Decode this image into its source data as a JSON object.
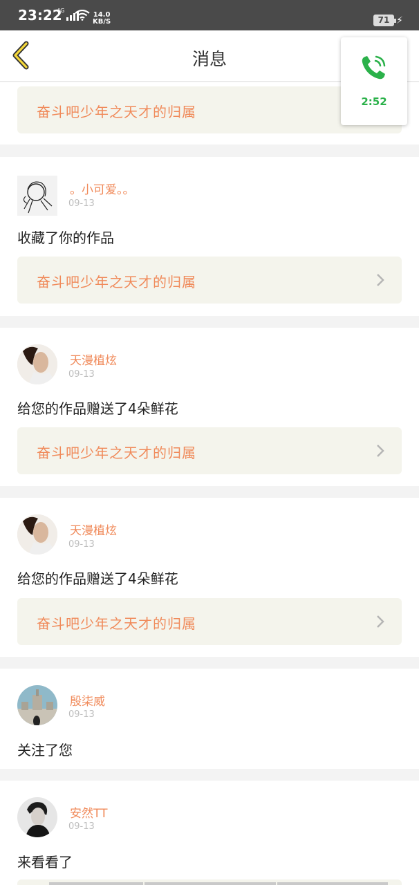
{
  "status": {
    "time": "23:22",
    "network": "4G",
    "speed_value": "14.0",
    "speed_unit": "KB/S",
    "battery": "71"
  },
  "nav": {
    "title": "消息"
  },
  "call": {
    "duration": "2:52",
    "color": "#2bb14a"
  },
  "feed": {
    "top_work_title": "奋斗吧少年之天才的归属",
    "items": [
      {
        "user": "。小可爱。。",
        "date": "09-13",
        "action": "收藏了你的作品",
        "work": "奋斗吧少年之天才的归属"
      },
      {
        "user": "天漫植炫",
        "date": "09-13",
        "action": "给您的作品赠送了4朵鲜花",
        "work": "奋斗吧少年之天才的归属"
      },
      {
        "user": "天漫植炫",
        "date": "09-13",
        "action": "给您的作品赠送了4朵鲜花",
        "work": "奋斗吧少年之天才的归属"
      },
      {
        "user": "殷柒威",
        "date": "09-13",
        "action": "关注了您"
      },
      {
        "user": "安然TT",
        "date": "09-13",
        "action": "来看看了"
      }
    ]
  },
  "colors": {
    "accent": "#f08a5a",
    "work_bg": "#f4f4ec",
    "date": "#bdbdbd"
  }
}
